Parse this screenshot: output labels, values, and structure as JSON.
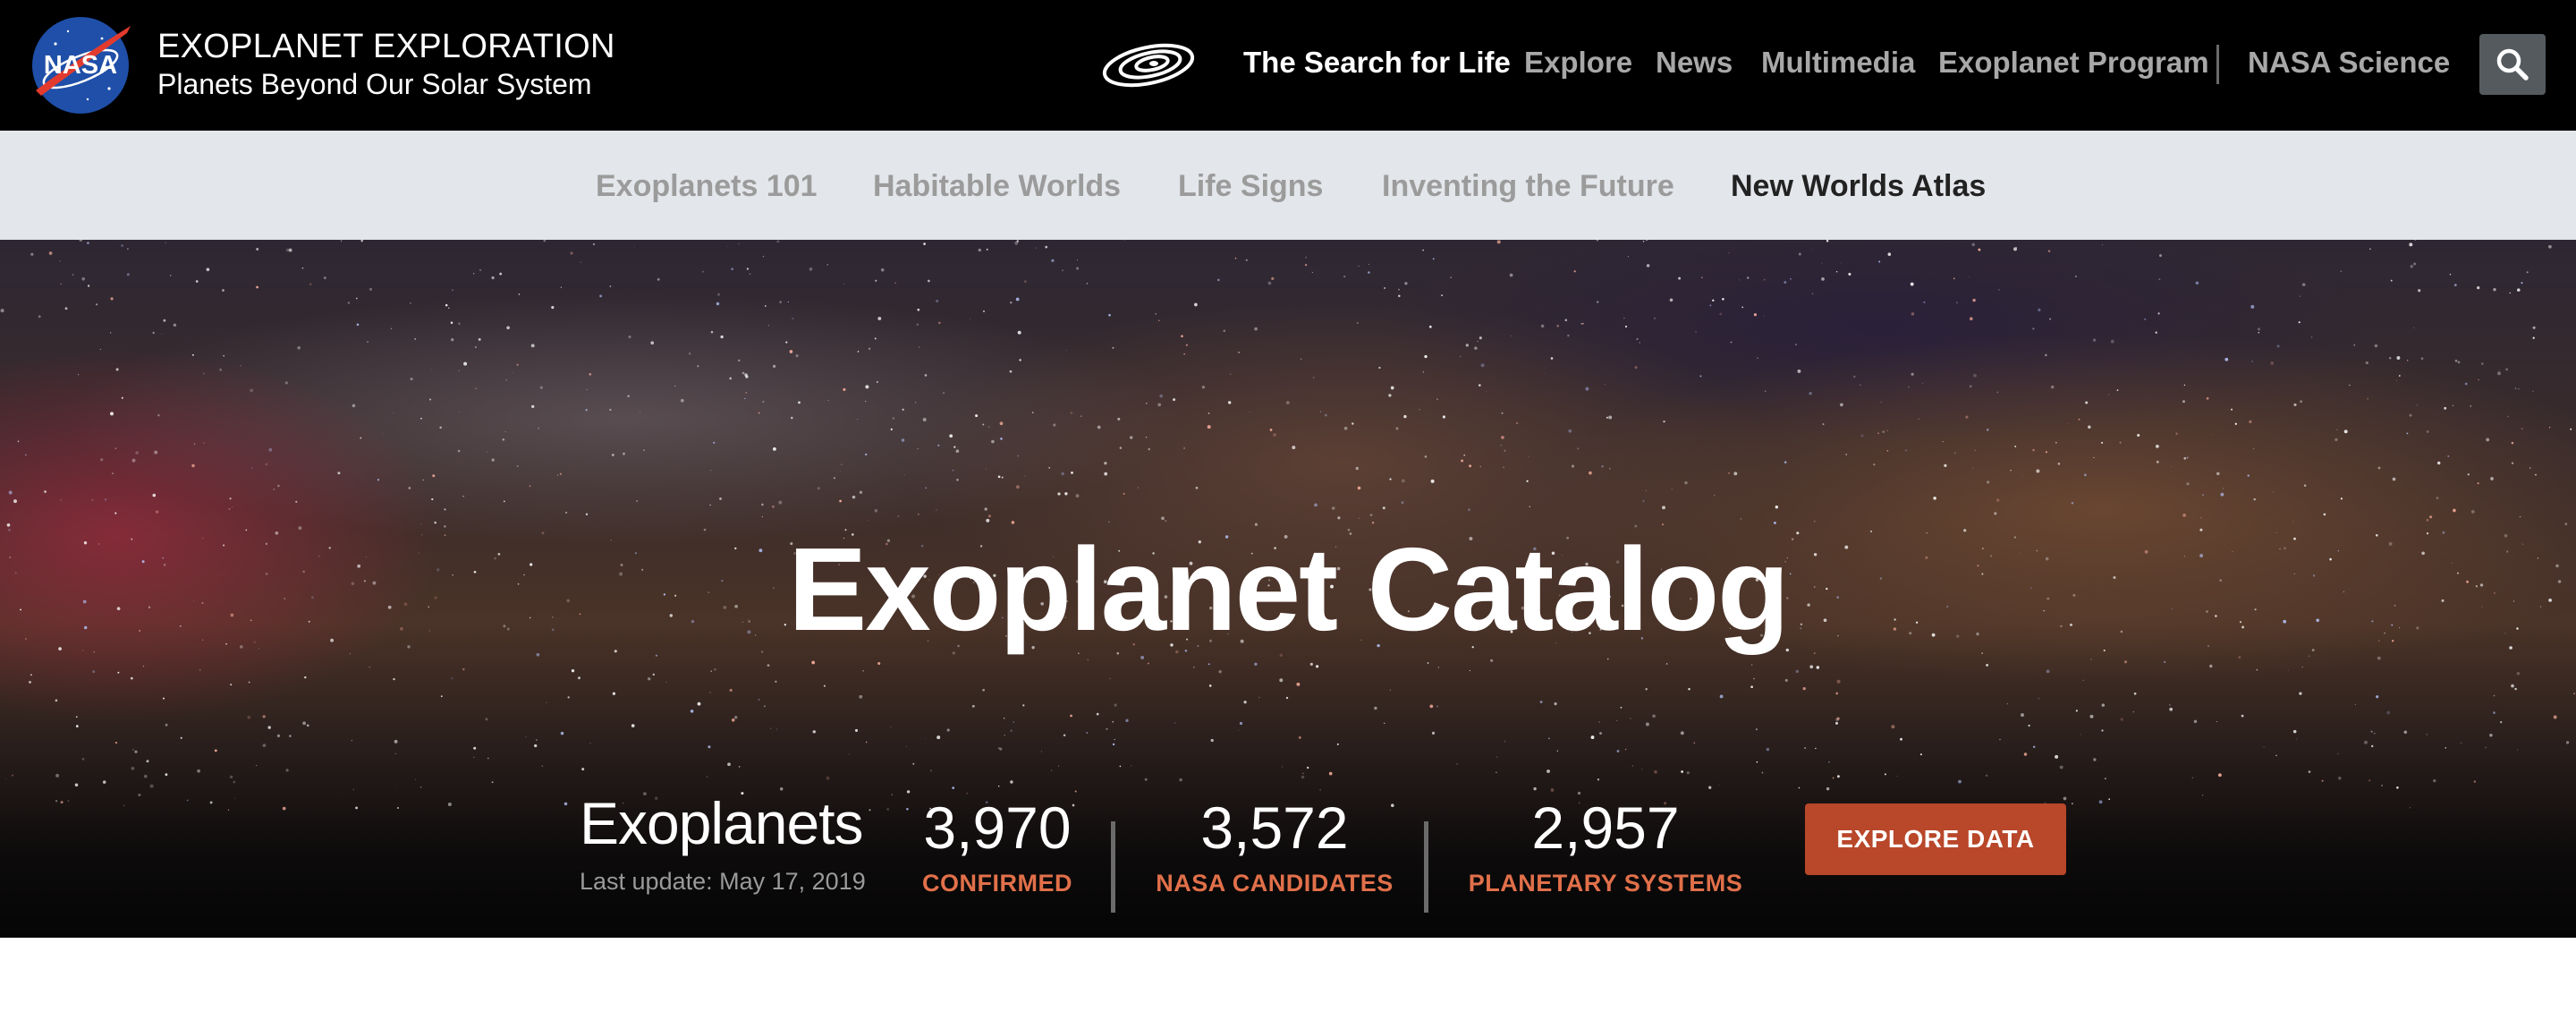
{
  "header": {
    "logo_text": "NASA",
    "title": "EXOPLANET EXPLORATION",
    "subtitle": "Planets Beyond Our Solar System",
    "nav": [
      {
        "label": "The Search for Life",
        "active": true
      },
      {
        "label": "Explore"
      },
      {
        "label": "News"
      },
      {
        "label": "Multimedia"
      },
      {
        "label": "Exoplanet Program"
      },
      {
        "label": "NASA Science"
      }
    ],
    "icons": {
      "galaxy": "galaxy-icon",
      "search": "search-icon"
    }
  },
  "subnav": [
    {
      "label": "Exoplanets 101"
    },
    {
      "label": "Habitable Worlds"
    },
    {
      "label": "Life Signs"
    },
    {
      "label": "Inventing the Future"
    },
    {
      "label": "New Worlds Atlas",
      "active": true
    }
  ],
  "hero": {
    "title": "Exoplanet Catalog",
    "stats_heading": "Exoplanets",
    "last_update": "Last update: May 17, 2019",
    "stats": [
      {
        "value": "3,970",
        "label": "CONFIRMED"
      },
      {
        "value": "3,572",
        "label": "NASA CANDIDATES"
      },
      {
        "value": "2,957",
        "label": "PLANETARY SYSTEMS"
      }
    ],
    "cta": "EXPLORE DATA"
  },
  "colors": {
    "header_bg": "#000000",
    "subnav_bg": "#e3e6ea",
    "accent_label": "#e1704a",
    "cta_bg": "#b9472a"
  }
}
